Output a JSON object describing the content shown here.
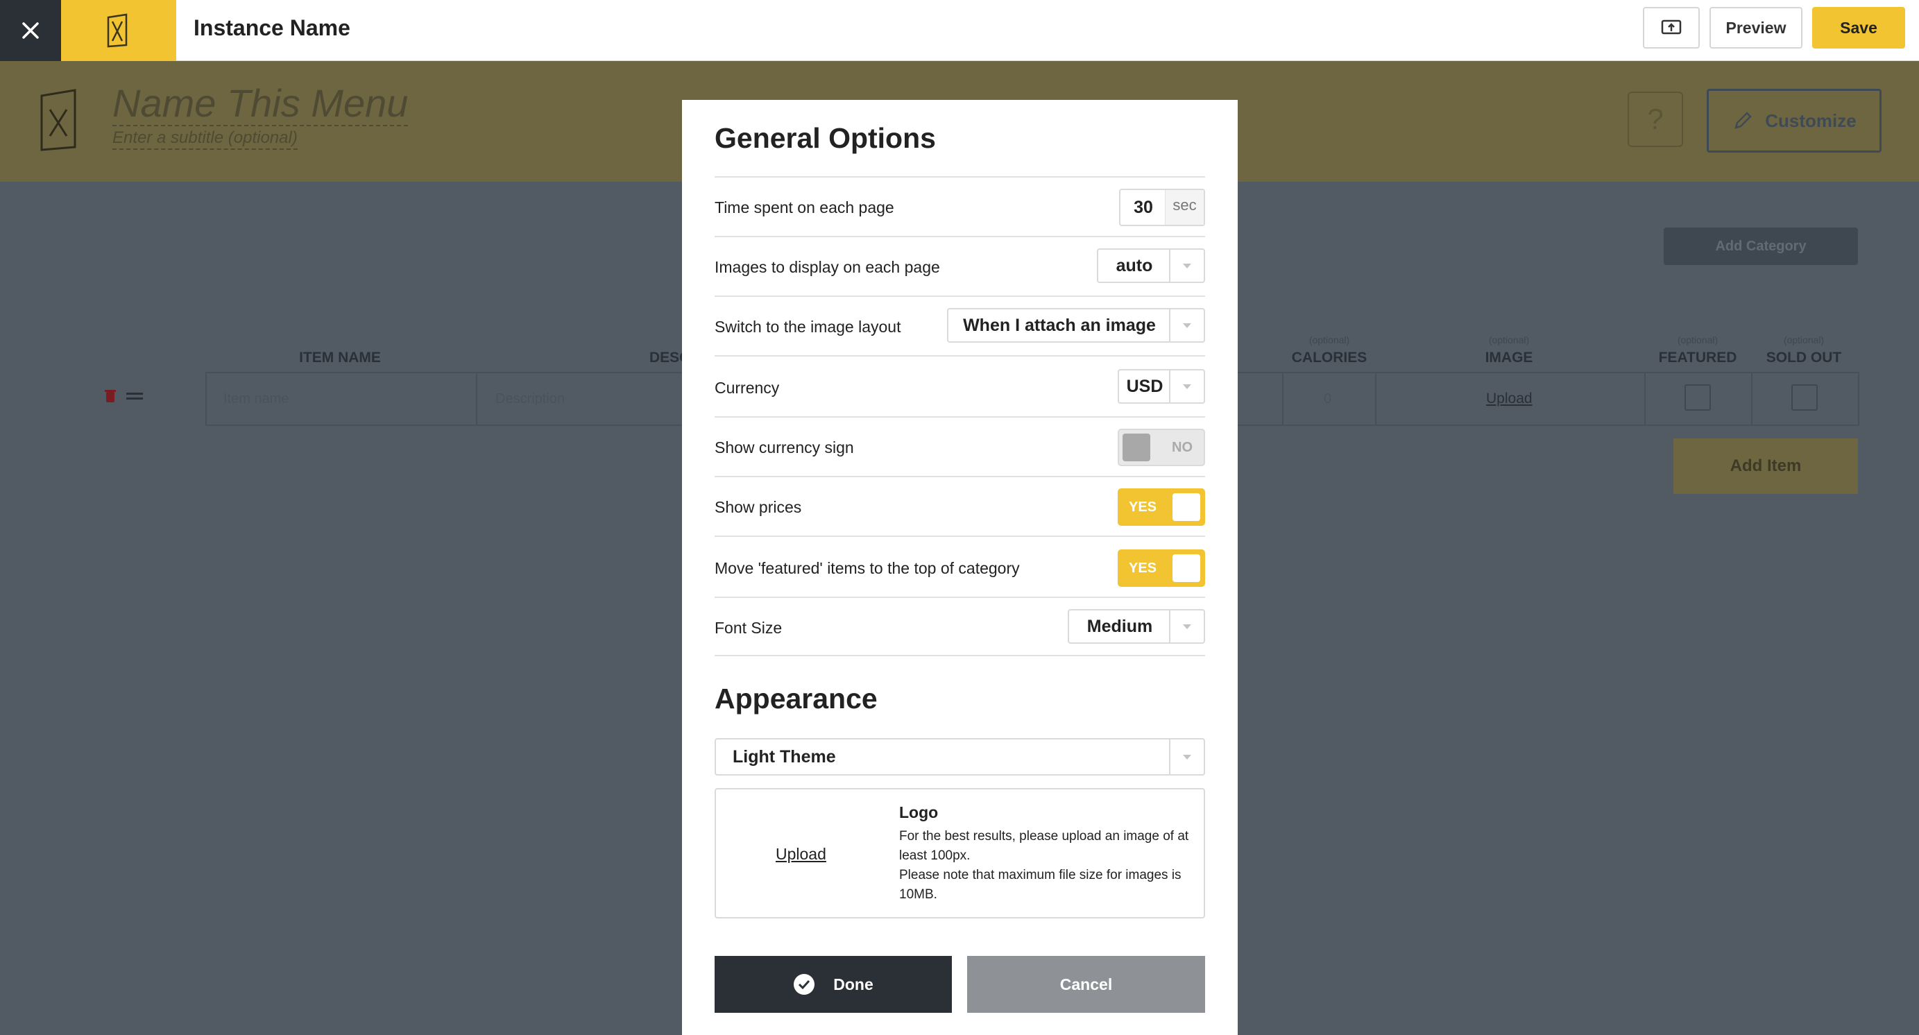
{
  "topbar": {
    "close_icon": "close-icon",
    "logo_icon": "menu-fork-knife-icon",
    "instance_name": "Instance Name",
    "share_icon": "screen-share-icon",
    "preview_label": "Preview",
    "save_label": "Save",
    "accent_color": "#f2c431"
  },
  "background_editor": {
    "title_placeholder": "Name This Menu",
    "subtitle_placeholder": "Enter a subtitle (optional)",
    "help_label": "?",
    "customize_label": "Customize",
    "add_category_label": "Add Category",
    "columns": {
      "item_name": "ITEM NAME",
      "description": "DESC",
      "calories": "CALORIES",
      "image": "IMAGE",
      "featured": "FEATURED",
      "sold_out": "SOLD OUT",
      "optional": "(optional)"
    },
    "item_name_placeholder": "Item name",
    "description_placeholder": "Description",
    "calories_value": "0",
    "image_upload_label": "Upload",
    "add_item_label": "Add Item"
  },
  "modal": {
    "general_title": "General Options",
    "options": {
      "time_per_page": {
        "label": "Time spent on each page",
        "value": "30",
        "unit": "sec"
      },
      "images_per_page": {
        "label": "Images to display on each page",
        "value": "auto"
      },
      "image_layout": {
        "label": "Switch to the image layout",
        "value": "When I attach an image"
      },
      "currency": {
        "label": "Currency",
        "value": "USD"
      },
      "show_currency_sign": {
        "label": "Show currency sign",
        "state": "NO"
      },
      "show_prices": {
        "label": "Show prices",
        "state": "YES"
      },
      "move_featured": {
        "label": "Move 'featured' items to the top of category",
        "state": "YES"
      },
      "font_size": {
        "label": "Font Size",
        "value": "Medium"
      }
    },
    "appearance_title": "Appearance",
    "theme_value": "Light Theme",
    "logo": {
      "upload_label": "Upload",
      "title": "Logo",
      "help_line1": "For the best results, please upload an image of at least 100px.",
      "help_line2": "Please note that maximum file size for images is 10MB."
    },
    "done_label": "Done",
    "cancel_label": "Cancel"
  }
}
